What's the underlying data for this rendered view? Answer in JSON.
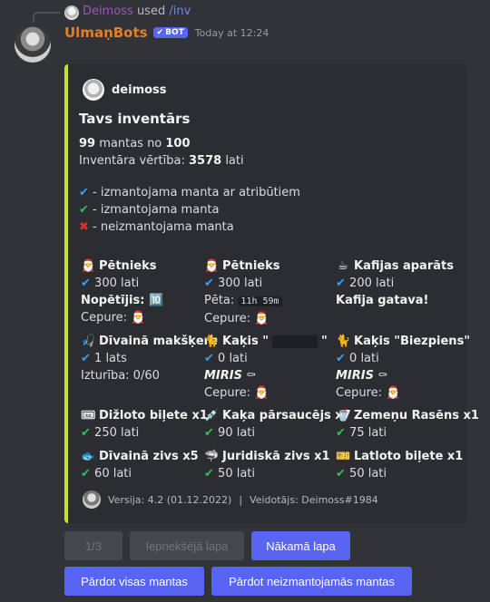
{
  "reply": {
    "username": "Deimoss",
    "used_text": "used",
    "command": "/inv"
  },
  "message": {
    "bot_name": "UlmaņBots",
    "bot_badge": "BOT",
    "timestamp": "Today at 12:24"
  },
  "embed": {
    "accent_color": "#c8df3a",
    "author": "deimoss",
    "title": "Tavs inventārs",
    "summary": {
      "count": "99",
      "count_mid": " mantas no ",
      "max": "100",
      "value_label": "Inventāra vērtība: ",
      "value": "3578",
      "value_unit": " lati"
    },
    "legend": [
      {
        "icon": "blue-check-icon",
        "text": " - izmantojama manta ar atribūtiem"
      },
      {
        "icon": "green-check-icon",
        "text": " - izmantojama manta"
      },
      {
        "icon": "red-cross-icon",
        "text": " - neizmantojama manta"
      }
    ],
    "fields": [
      {
        "name": "Pētnieks",
        "emoji": "🎅",
        "status": "blue",
        "value": "300 lati",
        "extra1_label": "Nopētījis: ",
        "extra1_value": "🔟",
        "extra2": "Cepure: ",
        "extra2_emoji": "🎅"
      },
      {
        "name": "Pētnieks",
        "emoji": "🎅",
        "status": "blue",
        "value": "300 lati",
        "extra1_label": "Pēta: ",
        "extra1_code": "11h 59m",
        "extra2": "Cepure: ",
        "extra2_emoji": "🎅"
      },
      {
        "name": "Kafijas aparāts",
        "emoji": "☕",
        "status": "blue",
        "value": "200 lati",
        "extra1_bold": "Kafija gatava!"
      },
      {
        "name": "Dīvainā makšķere",
        "emoji": "🎣",
        "status": "blue",
        "value": "1 lats",
        "extra1_label": "Izturība: 0/60"
      },
      {
        "name_pre": "Kaķis \"",
        "name_post": "\"",
        "emoji": "🐈",
        "status": "blue",
        "value": "0 lati",
        "dead": "MIRIS",
        "dead_emoji": "⚰",
        "extra2": "Cepure: ",
        "extra2_emoji": "🎅"
      },
      {
        "name": "Kaķis \"Biezpiens\"",
        "emoji": "🐈",
        "status": "blue",
        "value": "0 lati",
        "dead": "MIRIS",
        "dead_emoji": "⚰",
        "extra2": "Cepure: ",
        "extra2_emoji": "🎅"
      },
      {
        "name": "Dižloto biļete x1",
        "emoji": "🎟",
        "status": "green",
        "value": "250 lati"
      },
      {
        "name": "Kaķa pārsaucējs x7",
        "emoji": "💉",
        "status": "green",
        "value": "90 lati"
      },
      {
        "name": "Zemeņu Rasēns x1",
        "emoji": "🥤",
        "status": "green",
        "value": "75 lati"
      },
      {
        "name": "Dīvainā zivs x5",
        "emoji": "🐟",
        "status": "green",
        "value": "60 lati"
      },
      {
        "name": "Juridiskā zivs x1",
        "emoji": "🦈",
        "status": "green",
        "value": "50 lati"
      },
      {
        "name": "Latloto biļete x1",
        "emoji": "🎫",
        "status": "green",
        "value": "50 lati"
      }
    ],
    "footer": {
      "version": "Versija: 4.2 (01.12.2022)",
      "separator": "|",
      "author": "Veidotājs: Deimoss#1984"
    }
  },
  "buttons": {
    "page": "1/3",
    "prev": "Iepriekšējā lapa",
    "next": "Nākamā lapa",
    "sell_all": "Pārdot visas mantas",
    "sell_unused": "Pārdot neizmantojamās mantas"
  }
}
